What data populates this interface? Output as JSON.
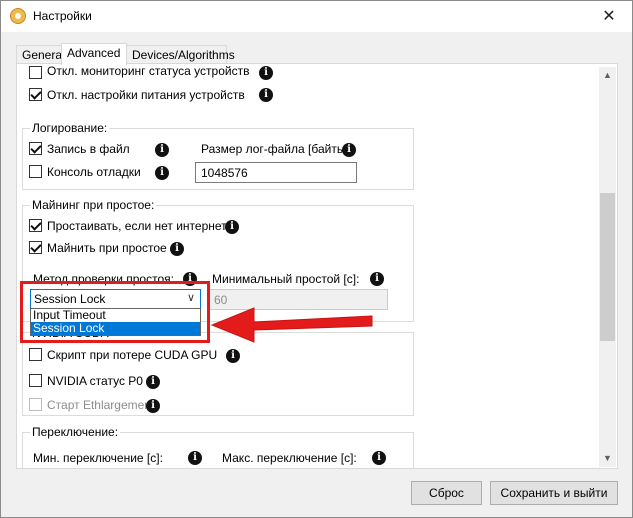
{
  "window": {
    "title": "Настройки",
    "close_glyph": "✕",
    "icon": "app-icon"
  },
  "tabs": [
    {
      "label": "General"
    },
    {
      "label": "Advanced",
      "active": true
    },
    {
      "label": "Devices/Algorithms"
    }
  ],
  "top_options": [
    {
      "label": "Откл. мониторинг статуса устройств",
      "checked": false
    },
    {
      "label": "Откл. настройки питания устройств",
      "checked": true
    }
  ],
  "logging": {
    "title": "Логирование:",
    "write_to_file": {
      "label": "Запись в файл",
      "checked": true
    },
    "debug_console": {
      "label": "Консоль отладки",
      "checked": false
    },
    "log_size_label": "Размер лог-файла [байты]:",
    "log_size_value": "1048576"
  },
  "idle_mining": {
    "title": "Майнинг при простое:",
    "idle_no_internet": {
      "label": "Простаивать, если нет интернета",
      "checked": true
    },
    "mine_when_idle": {
      "label": "Майнить при простое",
      "checked": true
    },
    "idle_check_label": "Метод проверки простоя:",
    "min_idle_label": "Минимальный простой [с]:",
    "min_idle_value": "60",
    "idle_method": {
      "selected": "Session Lock",
      "options": [
        "Input Timeout",
        "Session Lock"
      ],
      "highlighted_option": "Session Lock"
    }
  },
  "nvidia": {
    "title": "NVIDIA CUDA",
    "cuda_script": {
      "label": "Скрипт при потере CUDA GPU",
      "checked": false
    },
    "nvidia_p0": {
      "label": "NVIDIA статус P0",
      "checked": false
    },
    "ethlargement": {
      "label": "Старт Ethlargement",
      "checked": false,
      "disabled": true
    }
  },
  "switching": {
    "title": "Переключение:",
    "min_switch_label": "Мин. переключение [с]:",
    "max_switch_label": "Макс. переключение [с]:"
  },
  "buttons": {
    "reset": "Сброс",
    "save_exit": "Сохранить и выйти"
  },
  "info_glyph": "i",
  "scroll": {
    "up_glyph": "▲",
    "down_glyph": "▼"
  },
  "colors": {
    "accent": "#0078d7",
    "annotation_red": "#e31b1b"
  }
}
